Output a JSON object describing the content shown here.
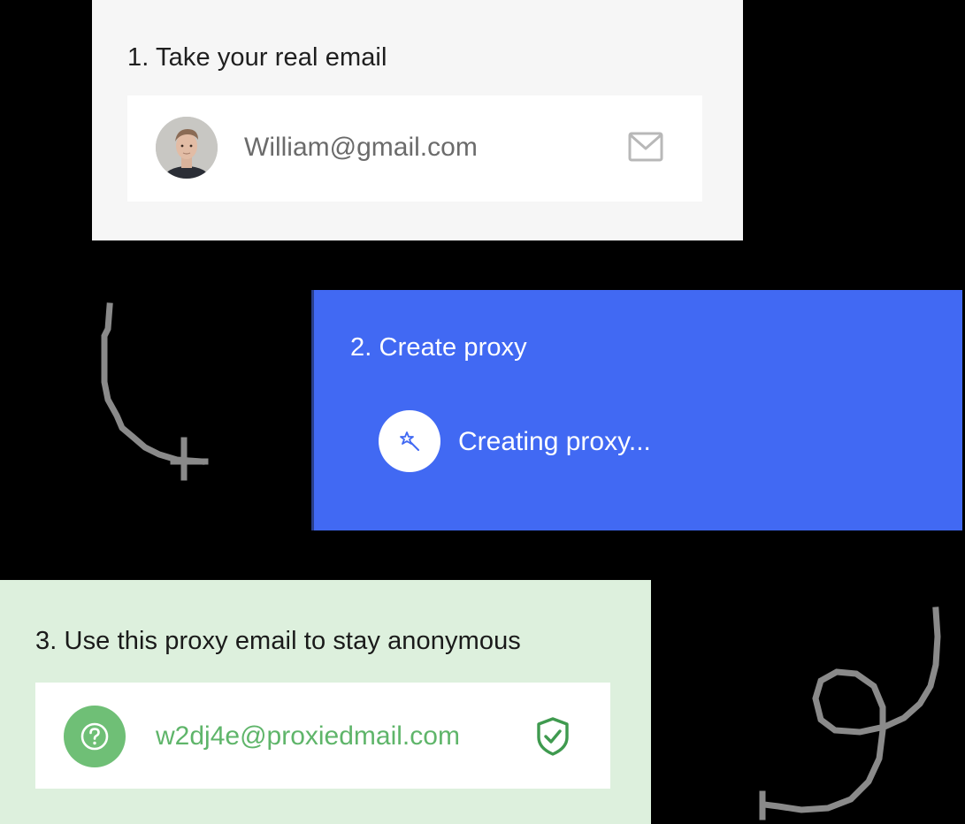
{
  "step1": {
    "title": "1. Take your real email",
    "email": "William@gmail.com",
    "avatar_icon": "user-avatar-photo",
    "trailing_icon": "mail-icon"
  },
  "step2": {
    "title": "2. Create proxy",
    "status": "Creating proxy...",
    "status_icon": "magic-wand-icon"
  },
  "step3": {
    "title": "3. Use this proxy email to stay anonymous",
    "email": "w2dj4e@proxiedmail.com",
    "leading_icon": "question-icon",
    "trailing_icon": "shield-check-icon"
  },
  "colors": {
    "background": "#000000",
    "card1_bg": "#f6f6f6",
    "card2_bg": "#4169f3",
    "card3_bg": "#ddf0dd",
    "proxy_green": "#5fb56a",
    "doodle_gray": "#8a8a8a"
  }
}
